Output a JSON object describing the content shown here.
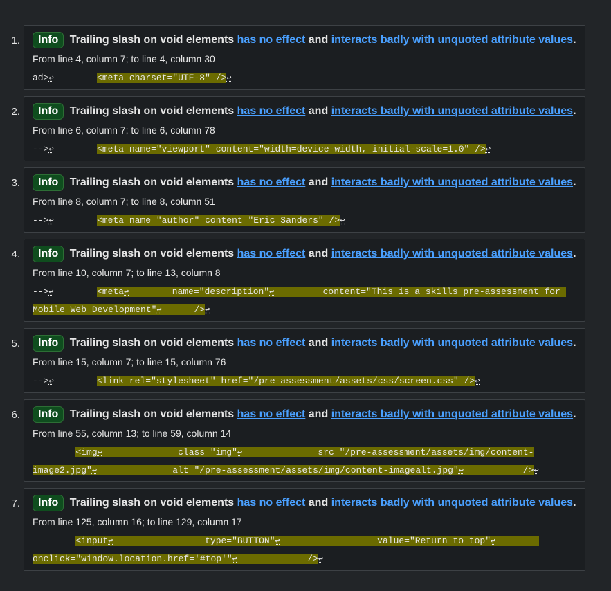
{
  "messages": [
    {
      "num": "1.",
      "badge": "Info",
      "title": "Trailing slash on void elements",
      "link1": "has no effect",
      "and": "and",
      "link2": "interacts badly with unquoted attribute values",
      "period": ".",
      "location": "From line 4, column 7; to line 4, column 30",
      "pre": "ad>",
      "gap": "        ",
      "code": "<meta charset=\"UTF-8\" />"
    },
    {
      "num": "2.",
      "badge": "Info",
      "title": "Trailing slash on void elements",
      "link1": "has no effect",
      "and": "and",
      "link2": "interacts badly with unquoted attribute values",
      "period": ".",
      "location": "From line 6, column 7; to line 6, column 78",
      "pre": "-->",
      "gap": "        ",
      "code": "<meta name=\"viewport\" content=\"width=device-width, initial-scale=1.0\" />"
    },
    {
      "num": "3.",
      "badge": "Info",
      "title": "Trailing slash on void elements",
      "link1": "has no effect",
      "and": "and",
      "link2": "interacts badly with unquoted attribute values",
      "period": ".",
      "location": "From line 8, column 7; to line 8, column 51",
      "pre": "-->",
      "gap": "        ",
      "code": "<meta name=\"author\" content=\"Eric Sanders\" />"
    },
    {
      "num": "4.",
      "badge": "Info",
      "title": "Trailing slash on void elements",
      "link1": "has no effect",
      "and": "and",
      "link2": "interacts badly with unquoted attribute values",
      "period": ".",
      "location": "From line 10, column 7; to line 13, column 8",
      "pre": "-->",
      "gap": "        ",
      "code_a": "<meta",
      "code_b": "        name=\"description\"",
      "code_c": "         content=\"This is a skills pre-assessment for ",
      "code_d": "Mobile Web Development\"",
      "code_e": "      />"
    },
    {
      "num": "5.",
      "badge": "Info",
      "title": "Trailing slash on void elements",
      "link1": "has no effect",
      "and": "and",
      "link2": "interacts badly with unquoted attribute values",
      "period": ".",
      "location": "From line 15, column 7; to line 15, column 76",
      "pre": "-->",
      "gap": "        ",
      "code": "<link rel=\"stylesheet\" href=\"/pre-assessment/assets/css/screen.css\" />"
    },
    {
      "num": "6.",
      "badge": "Info",
      "title": "Trailing slash on void elements",
      "link1": "has no effect",
      "and": "and",
      "link2": "interacts badly with unquoted attribute values",
      "period": ".",
      "location": "From line 55, column 13; to line 59, column 14",
      "pre": "        ",
      "code_a": "<img",
      "code_b": "              class=\"img\"",
      "code_c": "              src=\"/pre-assessment/assets/img/content-",
      "code_d": "image2.jpg\"",
      "code_e": "              alt=\"/pre-assessment/assets/img/content-imagealt.jpg\"",
      "code_f": "           />"
    },
    {
      "num": "7.",
      "badge": "Info",
      "title": "Trailing slash on void elements",
      "link1": "has no effect",
      "and": "and",
      "link2": "interacts badly with unquoted attribute values",
      "period": ".",
      "location": "From line 125, column 16; to line 129, column 17",
      "pre": "        ",
      "code_a": "<input",
      "code_b": "                 type=\"BUTTON\"",
      "code_c": "                  value=\"Return to top\"",
      "code_d": "onclick=\"window.location.href='#top'\"",
      "code_e": "             />"
    }
  ],
  "return_glyph": "↩"
}
